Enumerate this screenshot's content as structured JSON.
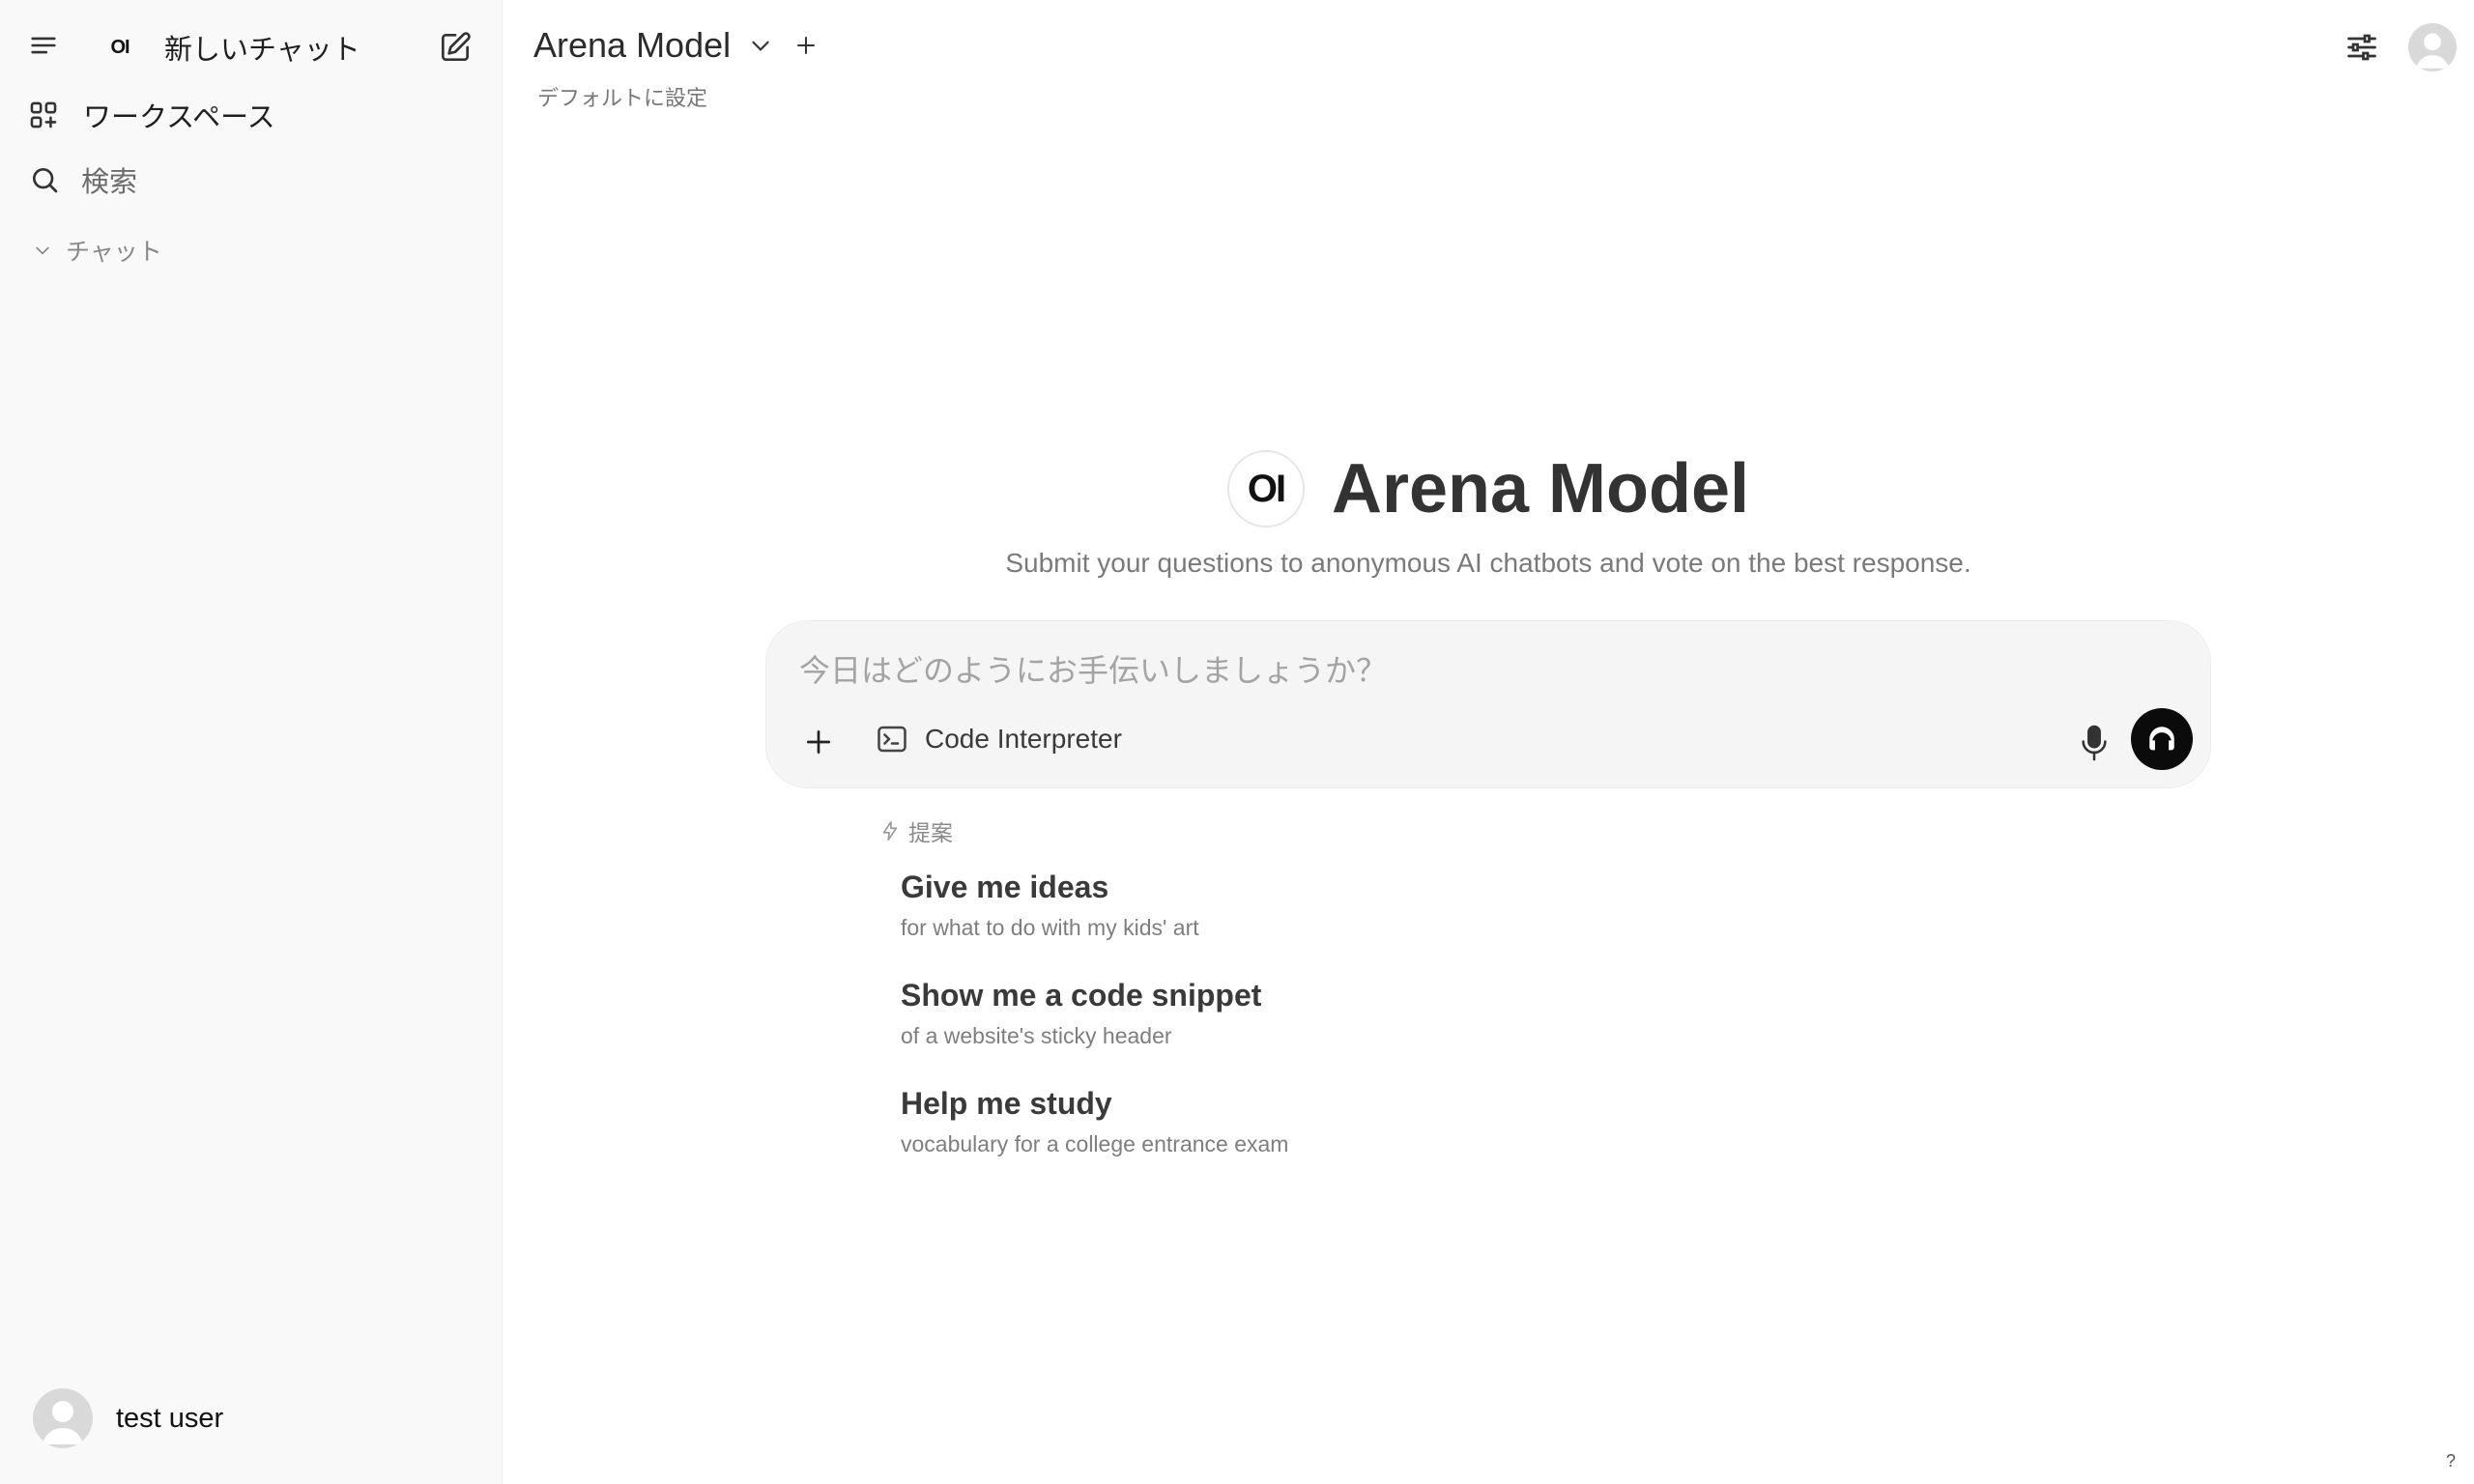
{
  "sidebar": {
    "new_chat_label": "新しいチャット",
    "brand_logo_text": "OI",
    "workspace_label": "ワークスペース",
    "search_label": "検索",
    "chats_section_label": "チャット",
    "user_name": "test user"
  },
  "header": {
    "model_name": "Arena Model",
    "set_default_label": "デフォルトに設定"
  },
  "hero": {
    "logo_text": "OI",
    "title": "Arena Model",
    "subtitle": "Submit your questions to anonymous AI chatbots and vote on the best response."
  },
  "composer": {
    "placeholder": "今日はどのようにお手伝いしましょうか？",
    "value": "",
    "code_interpreter_label": "Code Interpreter"
  },
  "suggestions": {
    "heading": "提案",
    "items": [
      {
        "title": "Give me ideas",
        "subtitle": "for what to do with my kids' art"
      },
      {
        "title": "Show me a code snippet",
        "subtitle": "of a website's sticky header"
      },
      {
        "title": "Help me study",
        "subtitle": "vocabulary for a college entrance exam"
      }
    ]
  },
  "help_label": "?",
  "icons": {
    "menu": "menu-icon",
    "new_chat": "edit-icon",
    "workspace": "grid-plus-icon",
    "search": "search-icon",
    "chevron": "chevron-down-icon",
    "add_model": "plus-icon",
    "controls": "sliders-icon",
    "attach": "plus-icon",
    "code": "terminal-icon",
    "mic": "microphone-icon",
    "voice": "headphones-icon",
    "suggest": "bolt-icon"
  }
}
